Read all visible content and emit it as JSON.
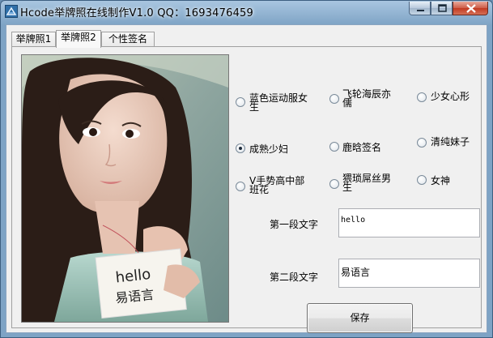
{
  "window": {
    "title": "Hcode举牌照在线制作V1.0    QQ：1693476459",
    "icon": "app-icon"
  },
  "tabs": [
    {
      "label": "举牌照1",
      "active": false
    },
    {
      "label": "举牌照2",
      "active": true
    },
    {
      "label": "个性签名",
      "active": false
    }
  ],
  "photo": {
    "sign_line1": "hello",
    "sign_line2": "易语言"
  },
  "styles": [
    {
      "label": "蓝色运动服女生",
      "selected": false
    },
    {
      "label": "飞轮海辰亦儒",
      "selected": false
    },
    {
      "label": "少女心形",
      "selected": false
    },
    {
      "label": "成熟少妇",
      "selected": true
    },
    {
      "label": "鹿晗签名",
      "selected": false
    },
    {
      "label": "清纯妹子",
      "selected": false
    },
    {
      "label": "V手势高中部班花",
      "selected": false
    },
    {
      "label": "猥琐屌丝男生",
      "selected": false
    },
    {
      "label": "女神",
      "selected": false
    }
  ],
  "form": {
    "line1_label": "第一段文字",
    "line1_value": "hello",
    "line2_label": "第二段文字",
    "line2_value": "易语言",
    "save_label": "保存"
  }
}
